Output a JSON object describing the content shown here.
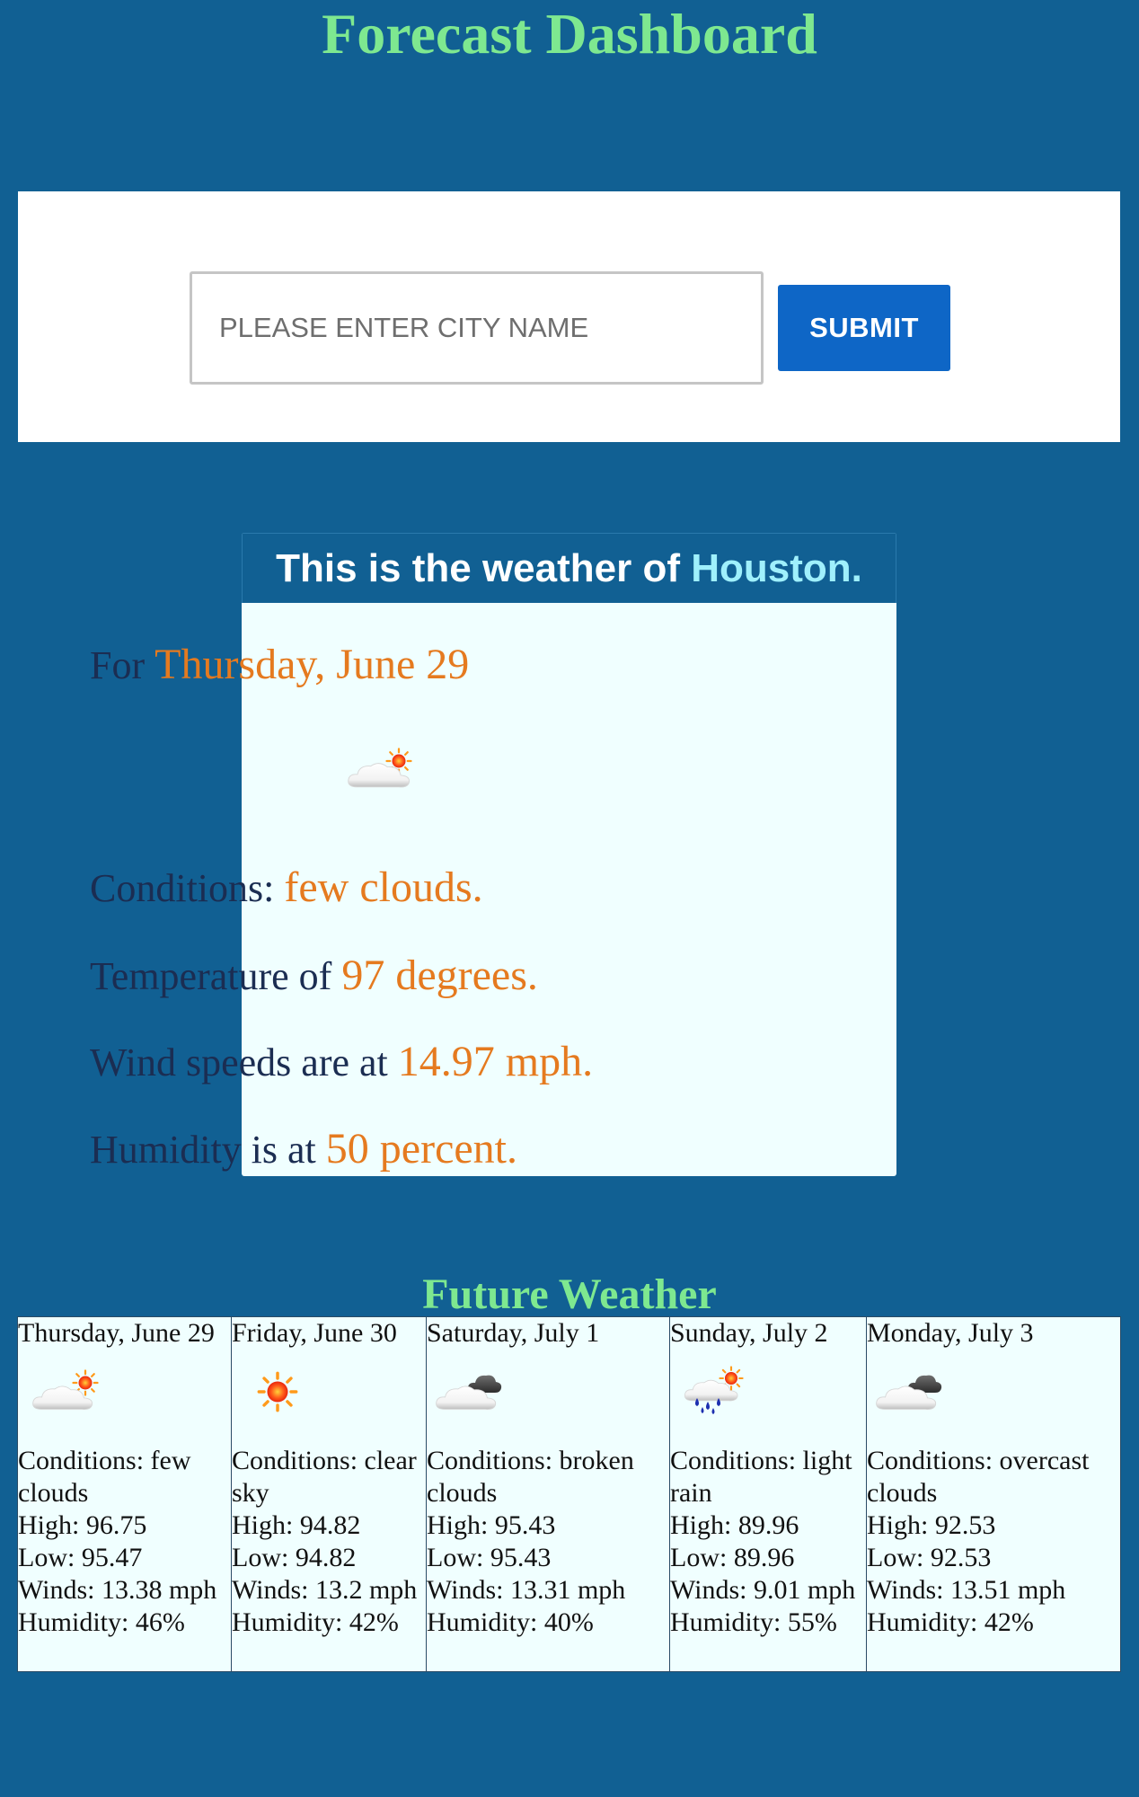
{
  "app": {
    "title": "Forecast Dashboard"
  },
  "search": {
    "placeholder": "PLEASE ENTER CITY NAME",
    "value": "",
    "submit_label": "SUBMIT"
  },
  "current": {
    "heading_prefix": "This is the weather of ",
    "city": "Houston.",
    "date_prefix": "For ",
    "date": "Thursday, June 29",
    "icon": "few-clouds-day-icon",
    "conditions_prefix": "Conditions: ",
    "conditions": "few clouds.",
    "temperature_prefix": "Temperature of ",
    "temperature": "97 degrees.",
    "wind_prefix": "Wind speeds are at ",
    "wind": "14.97 mph.",
    "humidity_prefix": "Humidity is at ",
    "humidity": "50 percent."
  },
  "future": {
    "title": "Future Weather",
    "days": [
      {
        "date": "Thursday, June 29",
        "icon": "few-clouds-day-icon",
        "conditions": "Conditions: few clouds",
        "high": "High: 96.75",
        "low": "Low: 95.47",
        "winds": "Winds: 13.38 mph",
        "humidity": "Humidity: 46%"
      },
      {
        "date": "Friday, June 30",
        "icon": "clear-sky-sun-icon",
        "conditions": "Conditions: clear sky",
        "high": "High: 94.82",
        "low": "Low: 94.82",
        "winds": "Winds: 13.2 mph",
        "humidity": "Humidity: 42%"
      },
      {
        "date": "Saturday, July 1",
        "icon": "broken-clouds-icon",
        "conditions": "Conditions: broken clouds",
        "high": "High: 95.43",
        "low": "Low: 95.43",
        "winds": "Winds: 13.31 mph",
        "humidity": "Humidity: 40%"
      },
      {
        "date": "Sunday, July 2",
        "icon": "light-rain-icon",
        "conditions": "Conditions: light rain",
        "high": "High: 89.96",
        "low": "Low: 89.96",
        "winds": "Winds: 9.01 mph",
        "humidity": "Humidity: 55%"
      },
      {
        "date": "Monday, July 3",
        "icon": "overcast-clouds-icon",
        "conditions": "Conditions: overcast clouds",
        "high": "High: 92.53",
        "low": "Low: 92.53",
        "winds": "Winds: 13.51 mph",
        "humidity": "Humidity: 42%"
      }
    ]
  },
  "colors": {
    "page_background": "#116093",
    "title_green": "#7ee890",
    "card_background": "#f0ffff",
    "accent_orange": "#e57a1f",
    "city_cyan": "#9ff0fc",
    "button_blue": "#0e66c6"
  }
}
